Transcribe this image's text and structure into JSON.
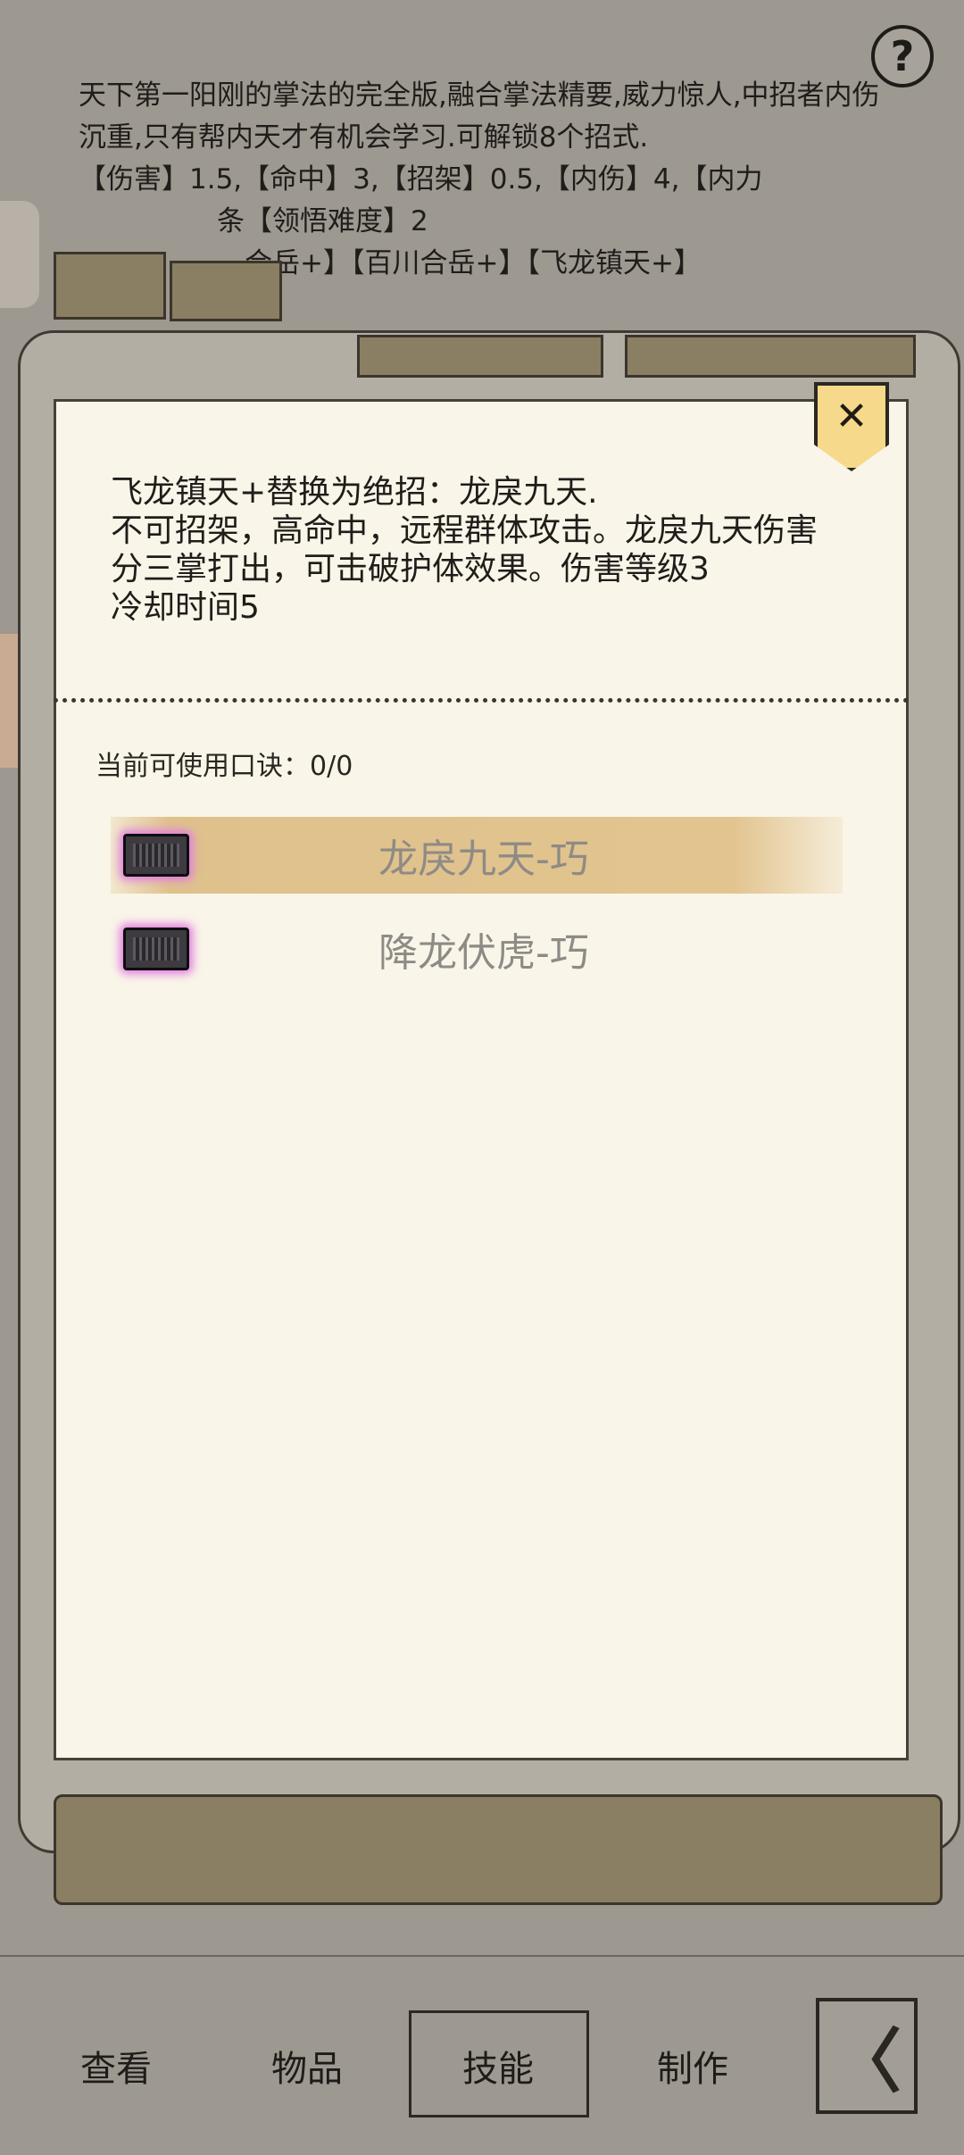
{
  "background": {
    "description": "天下第一阳刚的掌法的完全版,融合掌法精要,威力惊人,中招者内伤沉重,只有帮内天才有机会学习.可解锁8个招式.\n【伤害】1.5,【命中】3,【招架】0.5,【内伤】4,【内力\n　　　　　条【领悟难度】2\n　　　　　　合岳+】【百川合岳+】【飞龙镇天+】",
    "help_icon": "?"
  },
  "dialog": {
    "close_icon": "✕",
    "skill_description": "飞龙镇天+替换为绝招：龙戾九天.\n不可招架，高命中，远程群体攻击。龙戾九天伤害分三掌打出，可击破护体效果。伤害等级3\n冷却时间5",
    "koujue_label": "当前可使用口诀：0/0",
    "koujue_items": [
      {
        "name": "龙戾九天-巧",
        "selected": true
      },
      {
        "name": "降龙伏虎-巧",
        "selected": false
      }
    ]
  },
  "bottom_nav": {
    "view": "查看",
    "items": "物品",
    "skills": "技能",
    "craft": "制作",
    "back_icon": "〈"
  },
  "colors": {
    "dialog_bg": "#f9f5e8",
    "dim_bg": "#9d9890",
    "highlight": "#e2c48f",
    "close_tab": "#f6d98a",
    "book_glow": "#e07be0"
  }
}
